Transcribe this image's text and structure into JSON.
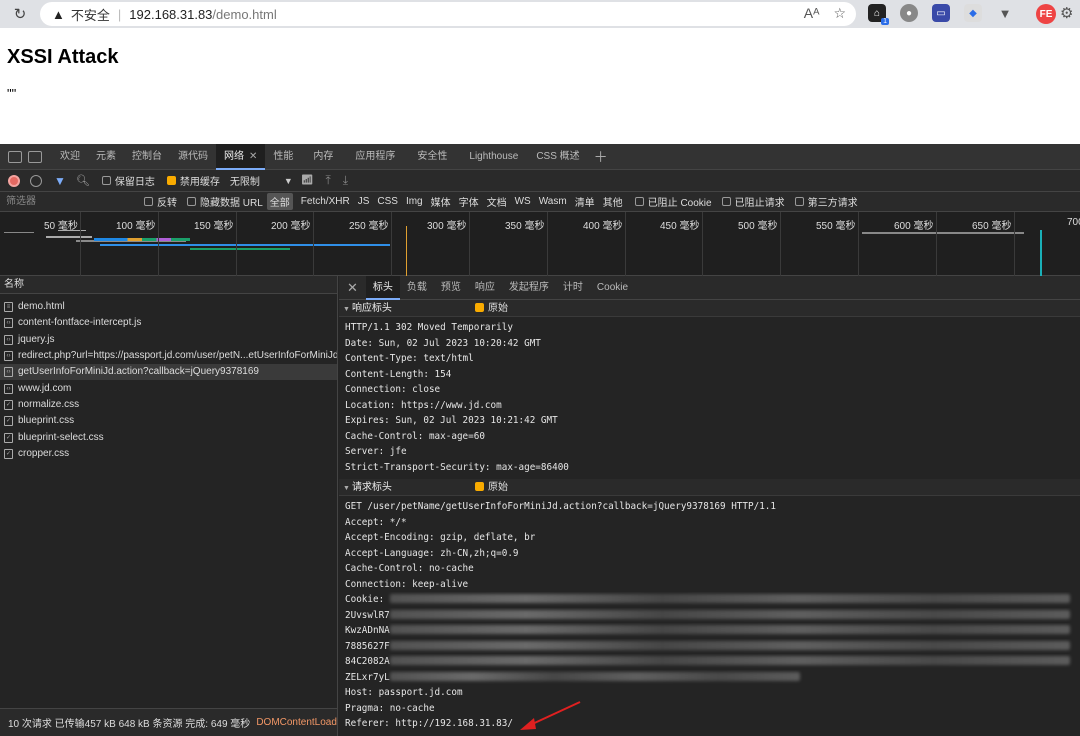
{
  "browser": {
    "insecure_label": "不安全",
    "url_host": "192.168.31.83",
    "url_path": "/demo.html",
    "profile_badge": "FE",
    "ext_badge": "1"
  },
  "page": {
    "title": "XSSI Attack",
    "body_text": "\"\""
  },
  "devtools": {
    "tabs": [
      "欢迎",
      "元素",
      "控制台",
      "源代码",
      "网络",
      "性能",
      "内存",
      "应用程序",
      "安全性",
      "Lighthouse",
      "CSS 概述"
    ],
    "active_tab": "网络",
    "toolbar": {
      "preserve_log": "保留日志",
      "disable_cache": "禁用缓存",
      "throttle": "无限制"
    },
    "filter": {
      "placeholder": "筛选器",
      "invert": "反转",
      "hide_data_urls": "隐藏数据 URL",
      "types": [
        "全部",
        "Fetch/XHR",
        "JS",
        "CSS",
        "Img",
        "媒体",
        "字体",
        "文档",
        "WS",
        "Wasm",
        "清单",
        "其他"
      ],
      "blocked_cookies": "已阻止 Cookie",
      "blocked_requests": "已阻止请求",
      "third_party": "第三方请求"
    },
    "timeline_ticks": [
      "50 毫秒",
      "100 毫秒",
      "150 毫秒",
      "200 毫秒",
      "250 毫秒",
      "300 毫秒",
      "350 毫秒",
      "400 毫秒",
      "450 毫秒",
      "500 毫秒",
      "550 毫秒",
      "600 毫秒",
      "650 毫秒",
      "700"
    ],
    "list_header": "名称",
    "requests": [
      {
        "name": "demo.html",
        "icon": "document-icon"
      },
      {
        "name": "content-fontface-intercept.js",
        "icon": "script-icon"
      },
      {
        "name": "jquery.js",
        "icon": "script-icon"
      },
      {
        "name": "redirect.php?url=https://passport.jd.com/user/petN...etUserInfoForMiniJd...",
        "icon": "script-icon"
      },
      {
        "name": "getUserInfoForMiniJd.action?callback=jQuery9378169",
        "icon": "script-icon"
      },
      {
        "name": "www.jd.com",
        "icon": "script-icon"
      },
      {
        "name": "normalize.css",
        "icon": "stylesheet-icon"
      },
      {
        "name": "blueprint.css",
        "icon": "stylesheet-icon"
      },
      {
        "name": "blueprint-select.css",
        "icon": "stylesheet-icon"
      },
      {
        "name": "cropper.css",
        "icon": "stylesheet-icon"
      }
    ],
    "status": {
      "summary": "10 次请求  已传输457 kB  648 kB 条资源  完成: 649 毫秒",
      "dcl": "DOMContentLoaded"
    },
    "detail_tabs": [
      "标头",
      "负载",
      "预览",
      "响应",
      "发起程序",
      "计时",
      "Cookie"
    ],
    "response_section": "响应标头",
    "raw_label": "原始",
    "response_headers": [
      "HTTP/1.1 302 Moved Temporarily",
      "Date: Sun, 02 Jul 2023 10:20:42 GMT",
      "Content-Type: text/html",
      "Content-Length: 154",
      "Connection: close",
      "Location: https://www.jd.com",
      "Expires: Sun, 02 Jul 2023 10:21:42 GMT",
      "Cache-Control: max-age=60",
      "Server: jfe",
      "Strict-Transport-Security: max-age=86400"
    ],
    "request_section": "请求标头",
    "request_headers_top": [
      "GET /user/petName/getUserInfoForMiniJd.action?callback=jQuery9378169 HTTP/1.1",
      "Accept: */*",
      "Accept-Encoding: gzip, deflate, br",
      "Accept-Language: zh-CN,zh;q=0.9",
      "Cache-Control: no-cache",
      "Connection: keep-alive"
    ],
    "cookie_lines": [
      "Cookie:",
      "2UvswlR7",
      "KwzADnNA",
      "7885627F",
      "84C2082A",
      "ZELxr7yL"
    ],
    "request_headers_bottom": [
      "Host: passport.jd.com",
      "Pragma: no-cache",
      "Referer: http://192.168.31.83/"
    ]
  }
}
